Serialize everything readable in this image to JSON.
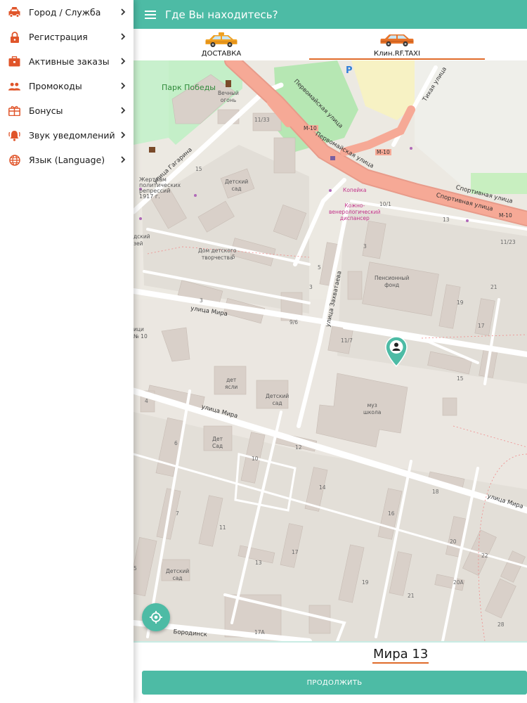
{
  "drawer": {
    "items": [
      {
        "label": "Город / Служба",
        "icon": "taxi-car-icon"
      },
      {
        "label": "Регистрация",
        "icon": "lock-icon"
      },
      {
        "label": "Активные заказы",
        "icon": "briefcase-icon"
      },
      {
        "label": "Промокоды",
        "icon": "people-icon"
      },
      {
        "label": "Бонусы",
        "icon": "gift-icon"
      },
      {
        "label": "Звук уведомлений",
        "icon": "bell-icon"
      },
      {
        "label": "Язык (Language)",
        "icon": "globe-icon"
      }
    ],
    "icon_color": "#e0552a"
  },
  "topbar": {
    "title": "Где Вы находитесь?",
    "color": "#4dbba5"
  },
  "tabs": [
    {
      "label": "ДОСТАВКА",
      "selected": false
    },
    {
      "label": "Клин.RF.TAXI",
      "selected": true
    }
  ],
  "map": {
    "park": "Парк Победы",
    "eternal_flame": [
      "Вечный",
      "огонь"
    ],
    "victims_memorial": [
      "Жертвам",
      "политических",
      "репрессий",
      "1917 г."
    ],
    "streets": {
      "gagarina": "улица Гагарина",
      "pervomayskaya_1": "Первомайская улица",
      "pervomayskaya_2": "Первомайская улица",
      "sportivnaya_1": "Спортивная улица",
      "sportivnaya_2": "Спортивная улица",
      "tikhaya": "Тихая улица",
      "zakhvataeva": "улица Захватаева",
      "mira_1": "улица Мира",
      "mira_2": "улица Мира",
      "mira_3": "улица Мира",
      "borodinskaya": "Бородинск"
    },
    "road_refs": [
      "M-10",
      "M-10",
      "M-10"
    ],
    "places": {
      "kindergarten_1": [
        "Детский",
        "сад"
      ],
      "children_house": [
        "Дом детского",
        "творчества"
      ],
      "clinic": [
        "Кожно-",
        "венерологический",
        "диспансер"
      ],
      "kopeika": "Копейка",
      "pension_fund": [
        "Пенсионный",
        "фонд"
      ],
      "nursery": [
        "дет",
        "ясли"
      ],
      "kindergarten_2": [
        "Детский",
        "сад"
      ],
      "music_school": [
        "муз",
        "школа"
      ],
      "kindergarten_3": [
        "Дет",
        "Сад"
      ],
      "kindergarten_4": [
        "Детский",
        "сад"
      ],
      "left_edge_1": [
        "дский",
        "зей"
      ],
      "left_edge_2": [
        "ици",
        "№ 10"
      ]
    },
    "house_numbers": [
      "11/33",
      "15",
      "10/1",
      "13",
      "11/23",
      "3",
      "5",
      "21",
      "19",
      "17",
      "15",
      "9/6",
      "11/7",
      "3",
      "5",
      "3",
      "4",
      "6",
      "10",
      "12",
      "14",
      "18",
      "16",
      "20",
      "22",
      "20A",
      "28",
      "21",
      "19",
      "17",
      "13",
      "11",
      "7",
      "5",
      "17A"
    ],
    "parking": "P"
  },
  "address": "Мира 13",
  "continue_label": "ПРОДОЛЖИТЬ",
  "accent_color": "#e06b2a"
}
